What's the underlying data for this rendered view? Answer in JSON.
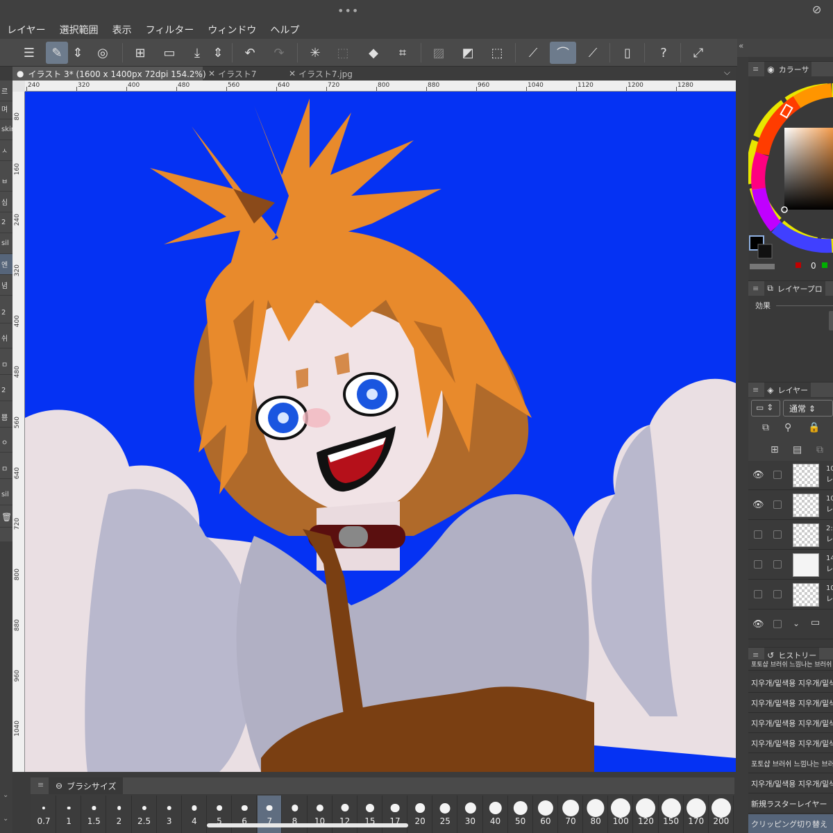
{
  "menubar": {
    "items": [
      "レイヤー",
      "選択範囲",
      "表示",
      "フィルター",
      "ウィンドウ",
      "ヘルプ"
    ]
  },
  "tabs": [
    {
      "label": "イラスト 3* (1600 x 1400px 72dpi 154.2%)",
      "active": true
    },
    {
      "label": "イラスト7",
      "active": false
    },
    {
      "label": "イラスト7.jpg",
      "active": false
    }
  ],
  "ruler": {
    "top_labels": [
      "240",
      "320",
      "400",
      "480",
      "560",
      "640",
      "720",
      "800",
      "880",
      "960",
      "1040",
      "1120",
      "1200",
      "1280"
    ],
    "left_labels": [
      "80",
      "160",
      "240",
      "320",
      "400",
      "480",
      "560",
      "640",
      "720",
      "800",
      "880",
      "960",
      "1040"
    ]
  },
  "left_strip": [
    "르",
    "며",
    "skin",
    "ㅅ",
    "ㅂ",
    "심",
    "2",
    "sil",
    "엔",
    "념",
    "2",
    "쉬",
    "ㅁ",
    "2",
    "쁨",
    "ㅇ",
    "ㅁ",
    "sil"
  ],
  "color_panel": {
    "title": "カラーサ",
    "value_r": "0",
    "accent": "#0532f3"
  },
  "layer_property": {
    "title": "レイヤープロ",
    "effect_label": "効果"
  },
  "layer_panel": {
    "title": "レイヤー",
    "blend_mode": "通常",
    "layers": [
      {
        "visible": true,
        "name": "10",
        "sub": "レ"
      },
      {
        "visible": true,
        "name": "10",
        "sub": "レ"
      },
      {
        "visible": false,
        "name": "2:",
        "sub": "レ"
      },
      {
        "visible": false,
        "name": "14",
        "sub": "レ"
      },
      {
        "visible": false,
        "name": "10",
        "sub": "レ"
      },
      {
        "visible": true,
        "name": "",
        "sub": ""
      }
    ]
  },
  "history_panel": {
    "title": "ヒストリー",
    "items": [
      "포토샵 브러쉬 느낌나는 브러쉬",
      "지우개/밑색용 지우개/밑색용",
      "지우개/밑색용 지우개/밑색용",
      "지우개/밑색용 지우개/밑색용",
      "지우개/밑색용 지우개/밑색용",
      "포토샵 브러쉬 느낌나는 브러쉬",
      "지우개/밑색용 지우개/밑색용",
      "新規ラスターレイヤー",
      "クリッピング切り替え"
    ]
  },
  "brush_panel": {
    "title": "ブラシサイズ",
    "sizes": [
      "0.7",
      "1",
      "1.5",
      "2",
      "2.5",
      "3",
      "4",
      "5",
      "6",
      "7",
      "8",
      "10",
      "12",
      "15",
      "17",
      "20",
      "25",
      "30",
      "40",
      "50",
      "60",
      "70",
      "80",
      "100",
      "120",
      "150",
      "170",
      "200"
    ],
    "selected": "7"
  }
}
